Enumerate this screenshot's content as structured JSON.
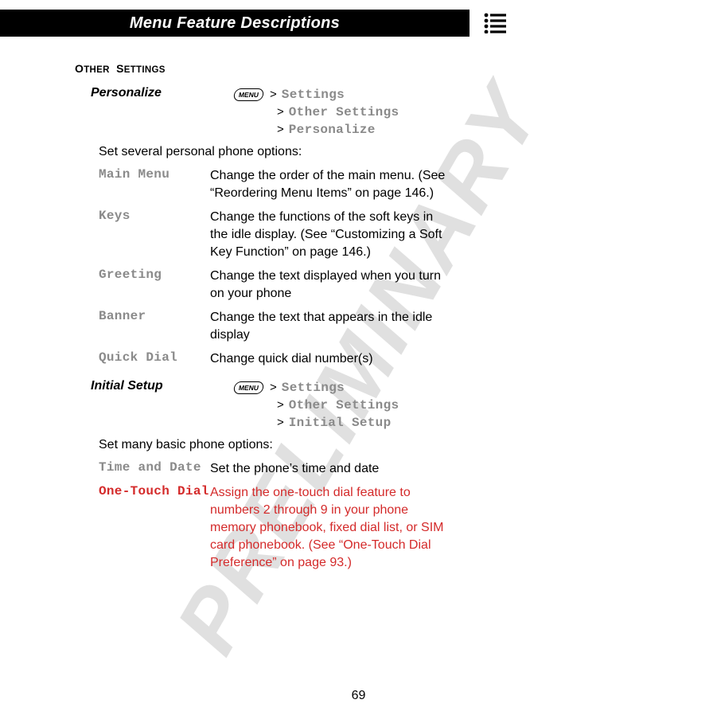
{
  "watermark": "PRELIMINARY",
  "header_title": "Menu Feature Descriptions",
  "menu_key_label": "MENU",
  "page_number": "69",
  "sections": {
    "other_settings": {
      "title_caps": "O",
      "title_sc1": "THER",
      "title_caps2": "S",
      "title_sc2": "ETTINGS",
      "personalize": {
        "label": "Personalize",
        "path0": "Settings",
        "path1": "Other Settings",
        "path2": "Personalize",
        "intro": "Set several personal phone options:",
        "options": [
          {
            "name": "Main Menu",
            "desc": "Change the order of the main menu. (See “Reordering Menu Items” on page 146.)"
          },
          {
            "name": "Keys",
            "desc": "Change the functions of the soft keys in the idle display. (See “Customizing a Soft Key Function” on page 146.)"
          },
          {
            "name": "Greeting",
            "desc": "Change the text displayed when you turn on your phone"
          },
          {
            "name": "Banner",
            "desc": "Change the text that appears in the idle display"
          },
          {
            "name": "Quick Dial",
            "desc": "Change quick dial number(s)"
          }
        ]
      },
      "initial_setup": {
        "label": "Initial Setup",
        "path0": "Settings",
        "path1": "Other Settings",
        "path2": "Initial Setup",
        "intro": "Set many basic phone options:",
        "options": [
          {
            "name": "Time and Date",
            "desc": "Set the phone’s time and date",
            "red": false
          },
          {
            "name": "One-Touch Dial",
            "desc": "Assign the one-touch dial feature to numbers 2 through 9 in your phone memory phonebook, fixed dial list, or SIM card phonebook. (See “One-Touch Dial Preference” on page 93.)",
            "red": true
          }
        ]
      }
    }
  }
}
